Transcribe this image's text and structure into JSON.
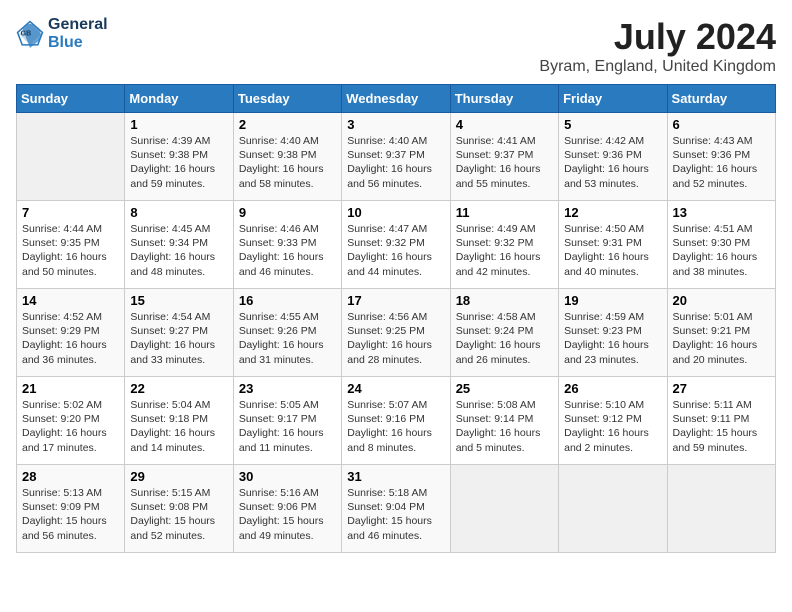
{
  "header": {
    "logo_line1": "General",
    "logo_line2": "Blue",
    "month_year": "July 2024",
    "location": "Byram, England, United Kingdom"
  },
  "weekdays": [
    "Sunday",
    "Monday",
    "Tuesday",
    "Wednesday",
    "Thursday",
    "Friday",
    "Saturday"
  ],
  "weeks": [
    [
      {
        "day": "",
        "sunrise": "",
        "sunset": "",
        "daylight": ""
      },
      {
        "day": "1",
        "sunrise": "Sunrise: 4:39 AM",
        "sunset": "Sunset: 9:38 PM",
        "daylight": "Daylight: 16 hours and 59 minutes."
      },
      {
        "day": "2",
        "sunrise": "Sunrise: 4:40 AM",
        "sunset": "Sunset: 9:38 PM",
        "daylight": "Daylight: 16 hours and 58 minutes."
      },
      {
        "day": "3",
        "sunrise": "Sunrise: 4:40 AM",
        "sunset": "Sunset: 9:37 PM",
        "daylight": "Daylight: 16 hours and 56 minutes."
      },
      {
        "day": "4",
        "sunrise": "Sunrise: 4:41 AM",
        "sunset": "Sunset: 9:37 PM",
        "daylight": "Daylight: 16 hours and 55 minutes."
      },
      {
        "day": "5",
        "sunrise": "Sunrise: 4:42 AM",
        "sunset": "Sunset: 9:36 PM",
        "daylight": "Daylight: 16 hours and 53 minutes."
      },
      {
        "day": "6",
        "sunrise": "Sunrise: 4:43 AM",
        "sunset": "Sunset: 9:36 PM",
        "daylight": "Daylight: 16 hours and 52 minutes."
      }
    ],
    [
      {
        "day": "7",
        "sunrise": "Sunrise: 4:44 AM",
        "sunset": "Sunset: 9:35 PM",
        "daylight": "Daylight: 16 hours and 50 minutes."
      },
      {
        "day": "8",
        "sunrise": "Sunrise: 4:45 AM",
        "sunset": "Sunset: 9:34 PM",
        "daylight": "Daylight: 16 hours and 48 minutes."
      },
      {
        "day": "9",
        "sunrise": "Sunrise: 4:46 AM",
        "sunset": "Sunset: 9:33 PM",
        "daylight": "Daylight: 16 hours and 46 minutes."
      },
      {
        "day": "10",
        "sunrise": "Sunrise: 4:47 AM",
        "sunset": "Sunset: 9:32 PM",
        "daylight": "Daylight: 16 hours and 44 minutes."
      },
      {
        "day": "11",
        "sunrise": "Sunrise: 4:49 AM",
        "sunset": "Sunset: 9:32 PM",
        "daylight": "Daylight: 16 hours and 42 minutes."
      },
      {
        "day": "12",
        "sunrise": "Sunrise: 4:50 AM",
        "sunset": "Sunset: 9:31 PM",
        "daylight": "Daylight: 16 hours and 40 minutes."
      },
      {
        "day": "13",
        "sunrise": "Sunrise: 4:51 AM",
        "sunset": "Sunset: 9:30 PM",
        "daylight": "Daylight: 16 hours and 38 minutes."
      }
    ],
    [
      {
        "day": "14",
        "sunrise": "Sunrise: 4:52 AM",
        "sunset": "Sunset: 9:29 PM",
        "daylight": "Daylight: 16 hours and 36 minutes."
      },
      {
        "day": "15",
        "sunrise": "Sunrise: 4:54 AM",
        "sunset": "Sunset: 9:27 PM",
        "daylight": "Daylight: 16 hours and 33 minutes."
      },
      {
        "day": "16",
        "sunrise": "Sunrise: 4:55 AM",
        "sunset": "Sunset: 9:26 PM",
        "daylight": "Daylight: 16 hours and 31 minutes."
      },
      {
        "day": "17",
        "sunrise": "Sunrise: 4:56 AM",
        "sunset": "Sunset: 9:25 PM",
        "daylight": "Daylight: 16 hours and 28 minutes."
      },
      {
        "day": "18",
        "sunrise": "Sunrise: 4:58 AM",
        "sunset": "Sunset: 9:24 PM",
        "daylight": "Daylight: 16 hours and 26 minutes."
      },
      {
        "day": "19",
        "sunrise": "Sunrise: 4:59 AM",
        "sunset": "Sunset: 9:23 PM",
        "daylight": "Daylight: 16 hours and 23 minutes."
      },
      {
        "day": "20",
        "sunrise": "Sunrise: 5:01 AM",
        "sunset": "Sunset: 9:21 PM",
        "daylight": "Daylight: 16 hours and 20 minutes."
      }
    ],
    [
      {
        "day": "21",
        "sunrise": "Sunrise: 5:02 AM",
        "sunset": "Sunset: 9:20 PM",
        "daylight": "Daylight: 16 hours and 17 minutes."
      },
      {
        "day": "22",
        "sunrise": "Sunrise: 5:04 AM",
        "sunset": "Sunset: 9:18 PM",
        "daylight": "Daylight: 16 hours and 14 minutes."
      },
      {
        "day": "23",
        "sunrise": "Sunrise: 5:05 AM",
        "sunset": "Sunset: 9:17 PM",
        "daylight": "Daylight: 16 hours and 11 minutes."
      },
      {
        "day": "24",
        "sunrise": "Sunrise: 5:07 AM",
        "sunset": "Sunset: 9:16 PM",
        "daylight": "Daylight: 16 hours and 8 minutes."
      },
      {
        "day": "25",
        "sunrise": "Sunrise: 5:08 AM",
        "sunset": "Sunset: 9:14 PM",
        "daylight": "Daylight: 16 hours and 5 minutes."
      },
      {
        "day": "26",
        "sunrise": "Sunrise: 5:10 AM",
        "sunset": "Sunset: 9:12 PM",
        "daylight": "Daylight: 16 hours and 2 minutes."
      },
      {
        "day": "27",
        "sunrise": "Sunrise: 5:11 AM",
        "sunset": "Sunset: 9:11 PM",
        "daylight": "Daylight: 15 hours and 59 minutes."
      }
    ],
    [
      {
        "day": "28",
        "sunrise": "Sunrise: 5:13 AM",
        "sunset": "Sunset: 9:09 PM",
        "daylight": "Daylight: 15 hours and 56 minutes."
      },
      {
        "day": "29",
        "sunrise": "Sunrise: 5:15 AM",
        "sunset": "Sunset: 9:08 PM",
        "daylight": "Daylight: 15 hours and 52 minutes."
      },
      {
        "day": "30",
        "sunrise": "Sunrise: 5:16 AM",
        "sunset": "Sunset: 9:06 PM",
        "daylight": "Daylight: 15 hours and 49 minutes."
      },
      {
        "day": "31",
        "sunrise": "Sunrise: 5:18 AM",
        "sunset": "Sunset: 9:04 PM",
        "daylight": "Daylight: 15 hours and 46 minutes."
      },
      {
        "day": "",
        "sunrise": "",
        "sunset": "",
        "daylight": ""
      },
      {
        "day": "",
        "sunrise": "",
        "sunset": "",
        "daylight": ""
      },
      {
        "day": "",
        "sunrise": "",
        "sunset": "",
        "daylight": ""
      }
    ]
  ]
}
